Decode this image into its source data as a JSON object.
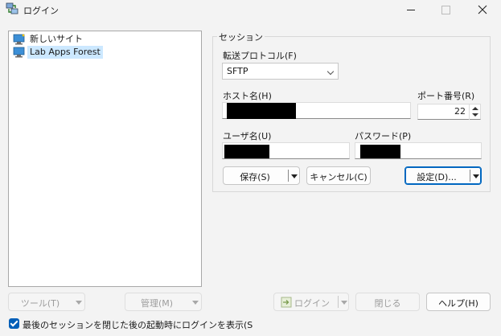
{
  "window": {
    "title": "ログイン"
  },
  "sites": [
    {
      "label": "新しいサイト",
      "selected": false
    },
    {
      "label": "Lab Apps Forest",
      "selected": true
    }
  ],
  "session": {
    "group_title": "セッション",
    "protocol_label": "転送プロトコル(F)",
    "protocol_value": "SFTP",
    "host_label": "ホスト名(H)",
    "port_label": "ポート番号(R)",
    "port_value": "22",
    "user_label": "ユーザ名(U)",
    "password_label": "パスワード(P)",
    "save_button": "保存(S)",
    "cancel_button": "キャンセル(C)",
    "settings_button": "設定(D)..."
  },
  "footer": {
    "tools_button": "ツール(T)",
    "manage_button": "管理(M)",
    "login_button": "ログイン",
    "close_button": "閉じる",
    "help_button": "ヘルプ(H)",
    "show_login_checkbox_label": "最後のセッションを閉じた後の起動時にログインを表示(S",
    "show_login_checked": true
  },
  "colors": {
    "accent": "#0067c0",
    "selection": "#cce8ff",
    "checkbox": "#005fb8"
  }
}
